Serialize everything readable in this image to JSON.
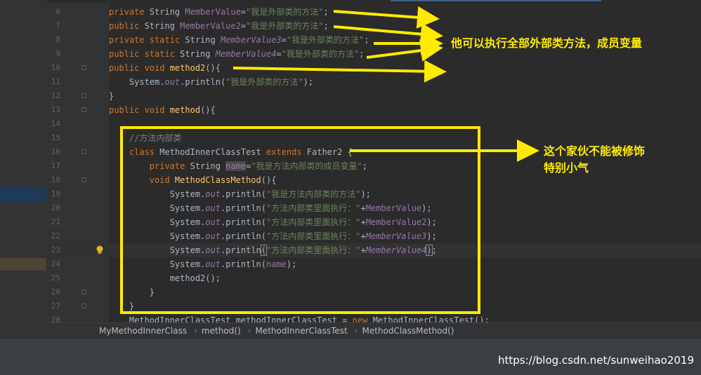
{
  "editor": {
    "lines": [
      {
        "n": "6",
        "tokens": [
          [
            "kw",
            "private "
          ],
          [
            "",
            "String "
          ],
          [
            "fld",
            "MemberValue"
          ],
          [
            "",
            "="
          ],
          [
            "str",
            "\"我是外部类的方法\""
          ],
          [
            "",
            ";"
          ]
        ]
      },
      {
        "n": "7",
        "tokens": [
          [
            "kw",
            "public "
          ],
          [
            "",
            "String "
          ],
          [
            "fld",
            "MemberValue2"
          ],
          [
            "",
            "="
          ],
          [
            "str",
            "\"我是外部类的方法\""
          ],
          [
            "",
            ";"
          ]
        ]
      },
      {
        "n": "8",
        "tokens": [
          [
            "kw",
            "private static "
          ],
          [
            "",
            "String "
          ],
          [
            "sfld",
            "MemberValue3"
          ],
          [
            "",
            "="
          ],
          [
            "str",
            "\"我是外部类的方法\""
          ],
          [
            "",
            ";"
          ]
        ]
      },
      {
        "n": "9",
        "tokens": [
          [
            "kw",
            "public static "
          ],
          [
            "",
            "String "
          ],
          [
            "sfld",
            "MemberValue4"
          ],
          [
            "",
            "="
          ],
          [
            "str",
            "\"我是外部类的方法\""
          ],
          [
            "",
            ";"
          ]
        ]
      },
      {
        "n": "10",
        "tokens": [
          [
            "kw",
            "public void "
          ],
          [
            "fn",
            "method2"
          ],
          [
            "",
            "(){"
          ]
        ]
      },
      {
        "n": "11",
        "tokens": [
          [
            "",
            "    System."
          ],
          [
            "sfld",
            "out"
          ],
          [
            "",
            ".println("
          ],
          [
            "str",
            "\"我是外部类的方法\""
          ],
          [
            "",
            ");"
          ]
        ]
      },
      {
        "n": "12",
        "tokens": [
          [
            "",
            "}"
          ]
        ]
      },
      {
        "n": "13",
        "tokens": [
          [
            "kw",
            "public void "
          ],
          [
            "fn",
            "method"
          ],
          [
            "",
            "(){"
          ]
        ]
      },
      {
        "n": "14",
        "tokens": [
          [
            "",
            ""
          ]
        ]
      },
      {
        "n": "15",
        "tokens": [
          [
            "cm",
            "    //方法内部类"
          ]
        ]
      },
      {
        "n": "16",
        "tokens": [
          [
            "kw",
            "    class "
          ],
          [
            "",
            "MethodInnerClassTest "
          ],
          [
            "kw",
            "extends "
          ],
          [
            "",
            "Father2 {"
          ]
        ]
      },
      {
        "n": "17",
        "tokens": [
          [
            "kw",
            "        private "
          ],
          [
            "",
            "String "
          ],
          [
            "hl",
            "name"
          ],
          [
            "",
            "="
          ],
          [
            "str",
            "\"我是方法内部类的成员变量\""
          ],
          [
            "",
            ";"
          ]
        ]
      },
      {
        "n": "18",
        "tokens": [
          [
            "kw",
            "        void "
          ],
          [
            "fn",
            "MethodClassMethod"
          ],
          [
            "",
            "(){"
          ]
        ]
      },
      {
        "n": "19",
        "tokens": [
          [
            "",
            "            System."
          ],
          [
            "sfld",
            "out"
          ],
          [
            "",
            ".println("
          ],
          [
            "str",
            "\"我是方法内部类的方法\""
          ],
          [
            "",
            ");"
          ]
        ]
      },
      {
        "n": "20",
        "tokens": [
          [
            "",
            "            System."
          ],
          [
            "sfld",
            "out"
          ],
          [
            "",
            ".println("
          ],
          [
            "str",
            "\"方法内部类里面执行：\""
          ],
          [
            "",
            "+"
          ],
          [
            "fld",
            "MemberValue"
          ],
          [
            "",
            ");"
          ]
        ]
      },
      {
        "n": "21",
        "tokens": [
          [
            "",
            "            System."
          ],
          [
            "sfld",
            "out"
          ],
          [
            "",
            ".println("
          ],
          [
            "str",
            "\"方法内部类里面执行：\""
          ],
          [
            "",
            "+"
          ],
          [
            "fld",
            "MemberValue2"
          ],
          [
            "",
            ");"
          ]
        ]
      },
      {
        "n": "22",
        "tokens": [
          [
            "",
            "            System."
          ],
          [
            "sfld",
            "out"
          ],
          [
            "",
            ".println("
          ],
          [
            "str",
            "\"方法内部类里面执行：\""
          ],
          [
            "",
            "+"
          ],
          [
            "sfld",
            "MemberValue3"
          ],
          [
            "",
            ");"
          ]
        ]
      },
      {
        "n": "23",
        "tokens": [
          [
            "",
            "            System."
          ],
          [
            "sfld",
            "out"
          ],
          [
            "",
            ".println"
          ],
          [
            "brace",
            "("
          ],
          [
            "str",
            "\"方法内部类里面执行：\""
          ],
          [
            "",
            "+"
          ],
          [
            "sfld",
            "MemberValue4"
          ],
          [
            "brace",
            ")"
          ],
          [
            "",
            ";"
          ]
        ]
      },
      {
        "n": "24",
        "tokens": [
          [
            "",
            "            System."
          ],
          [
            "sfld",
            "out"
          ],
          [
            "",
            ".println("
          ],
          [
            "fld",
            "name"
          ],
          [
            "",
            ");"
          ]
        ]
      },
      {
        "n": "25",
        "tokens": [
          [
            "",
            "            method2();"
          ]
        ]
      },
      {
        "n": "26",
        "tokens": [
          [
            "",
            "        }"
          ]
        ]
      },
      {
        "n": "27",
        "tokens": [
          [
            "",
            "    }"
          ]
        ]
      },
      {
        "n": "28",
        "tokens": [
          [
            "",
            "    MethodInnerClassTest methodInnerClassTest = "
          ],
          [
            "kw",
            "new "
          ],
          [
            "",
            "MethodInnerClassTest();"
          ]
        ]
      }
    ]
  },
  "breadcrumb": {
    "items": [
      "MyMethodInnerClass",
      "method()",
      "MethodInnerClassTest",
      "MethodClassMethod()"
    ]
  },
  "annotations": {
    "top_text": "他可以执行全部外部类方法，成员变量",
    "box_text_line1": "这个家伙不能被修饰",
    "box_text_line2": "特别小气",
    "color": "#ffea00"
  },
  "watermark": "https://blog.csdn.net/sunweihao2019"
}
